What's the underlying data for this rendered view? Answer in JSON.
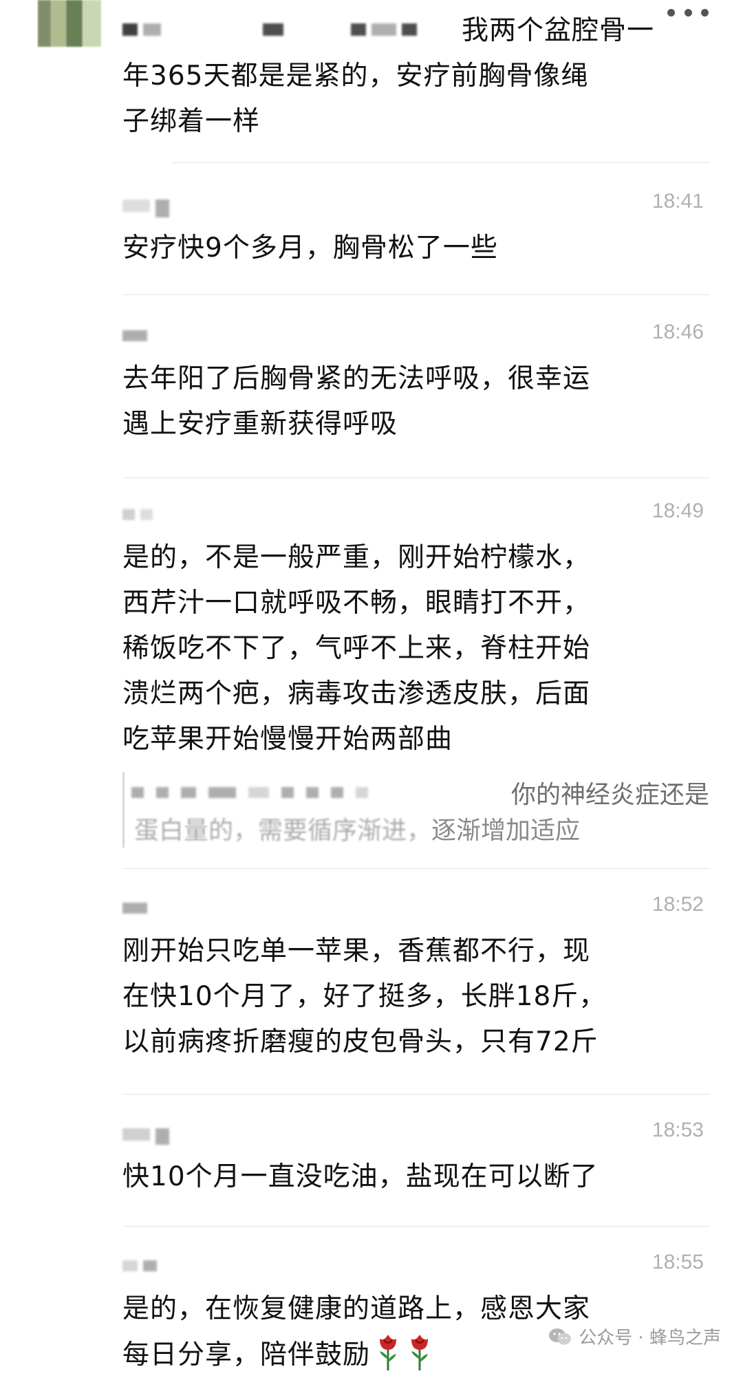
{
  "messages": [
    {
      "time": "",
      "text": "我两个盆腔骨一年365天都是是紧的，安疗前胸骨像绳子绑着一样",
      "line1": "我两个盆腔骨一",
      "line2": "年365天都是是紧的，安疗前胸骨像绳",
      "line3": "子绑着一样"
    },
    {
      "time": "18:41",
      "line1": "安疗快9个多月，胸骨松了一些"
    },
    {
      "time": "18:46",
      "line1": "去年阳了后胸骨紧的无法呼吸，很幸运",
      "line2": "遇上安疗重新获得呼吸"
    },
    {
      "time": "18:49",
      "line1": "是的，不是一般严重，刚开始柠檬水，",
      "line2": "西芹汁一口就呼吸不畅，眼睛打不开，",
      "line3": "稀饭吃不下了，气呼不上来，脊柱开始",
      "line4": "溃烂两个疤，病毒攻击渗透皮肤，后面",
      "line5": "吃苹果开始慢慢开始两部曲",
      "quote": {
        "line1": "你的神经炎症还是",
        "line2_faded": "蛋白量的，需要循序渐进，",
        "line2": "逐渐增加适应"
      }
    },
    {
      "time": "18:52",
      "line1": "刚开始只吃单一苹果，香蕉都不行，现",
      "line2": "在快10个月了，好了挺多，长胖18斤，",
      "line3": "以前病疼折磨瘦的皮包骨头，只有72斤"
    },
    {
      "time": "18:53",
      "line1": "快10个月一直没吃油，盐现在可以断了"
    },
    {
      "time": "18:55",
      "line1": "是的，在恢复健康的道路上，感恩大家",
      "line2": "每日分享，陪伴鼓励"
    }
  ],
  "watermark": {
    "text": "公众号 · 蜂鸟之声",
    "icon": "wechat-icon"
  },
  "icons": {
    "more": "more-dots-icon",
    "rose": "rose-icon"
  },
  "colors": {
    "time": "#b0b0b0",
    "text": "#111111",
    "divider": "#e4e4e4"
  }
}
